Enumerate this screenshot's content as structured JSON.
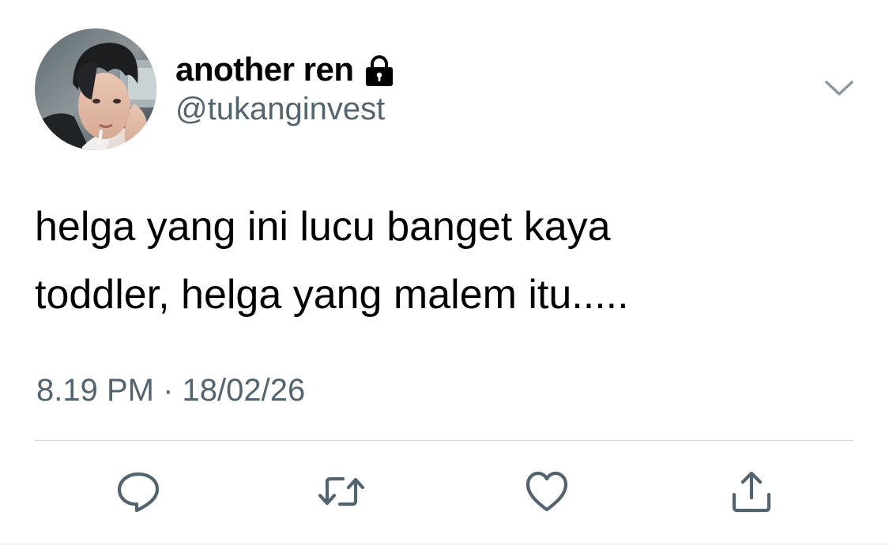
{
  "tweet": {
    "author": {
      "display_name": "another ren",
      "handle": "@tukanginvest",
      "protected_icon": "lock-icon",
      "avatar": "profile-photo"
    },
    "text_lines": [
      "helga yang ini lucu banget kaya",
      "toddler, helga yang malem itu....."
    ],
    "timestamp": "8.19 PM · 18/02/26",
    "menu_icon": "chevron-down-icon",
    "actions": [
      {
        "name": "reply",
        "icon": "reply-icon"
      },
      {
        "name": "retweet",
        "icon": "retweet-icon"
      },
      {
        "name": "like",
        "icon": "heart-icon"
      },
      {
        "name": "share",
        "icon": "share-icon"
      }
    ]
  },
  "colors": {
    "text": "#000000",
    "secondary_text": "#536471",
    "icon": "#536471",
    "divider": "#cfd9de",
    "background": "#ffffff"
  }
}
